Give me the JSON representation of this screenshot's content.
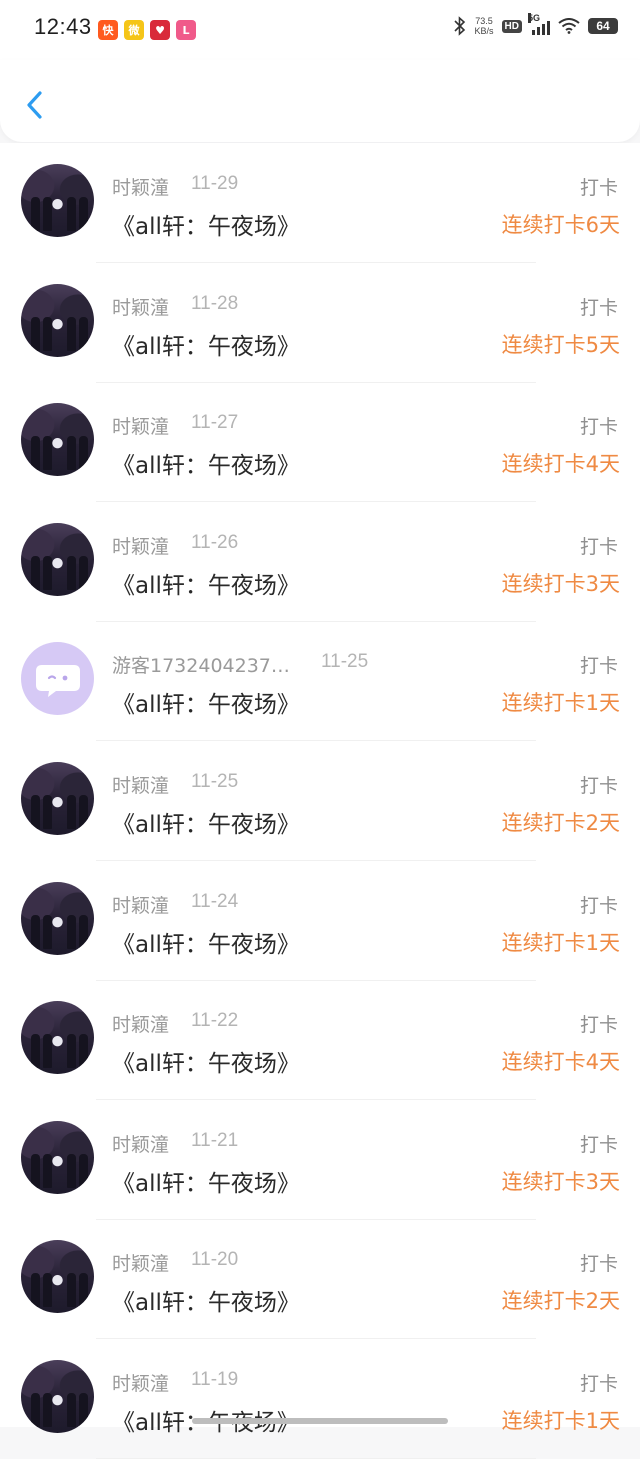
{
  "status_bar": {
    "time": "12:43",
    "app_icons": [
      {
        "name": "kuaishou-icon",
        "glyph": "快",
        "color": "#ff5a1f"
      },
      {
        "name": "weibo-icon",
        "glyph": "微",
        "color": "#f5c518"
      },
      {
        "name": "heart-app-icon",
        "glyph": "♥",
        "color": "#d92a3a"
      },
      {
        "name": "lofter-icon",
        "glyph": "L",
        "color": "#f05a8a"
      }
    ],
    "net_speed_value": "73.5",
    "net_speed_unit": "KB/s",
    "hd": "HD",
    "network": "5G",
    "battery": "64"
  },
  "header": {
    "back_icon": "chevron-left-icon",
    "accent_color": "#2d9cf0"
  },
  "colors": {
    "streak": "#ef8a43",
    "guest_avatar": "#d6c9f5"
  },
  "items": [
    {
      "name": "时颖潼",
      "date": "11-29",
      "title": "《all轩：午夜场》",
      "type": "打卡",
      "streak": "连续打卡6天",
      "avatar": "photo"
    },
    {
      "name": "时颖潼",
      "date": "11-28",
      "title": "《all轩：午夜场》",
      "type": "打卡",
      "streak": "连续打卡5天",
      "avatar": "photo"
    },
    {
      "name": "时颖潼",
      "date": "11-27",
      "title": "《all轩：午夜场》",
      "type": "打卡",
      "streak": "连续打卡4天",
      "avatar": "photo"
    },
    {
      "name": "时颖潼",
      "date": "11-26",
      "title": "《all轩：午夜场》",
      "type": "打卡",
      "streak": "连续打卡3天",
      "avatar": "photo"
    },
    {
      "name": "游客1732404237…",
      "date": "11-25",
      "title": "《all轩：午夜场》",
      "type": "打卡",
      "streak": "连续打卡1天",
      "avatar": "guest"
    },
    {
      "name": "时颖潼",
      "date": "11-25",
      "title": "《all轩：午夜场》",
      "type": "打卡",
      "streak": "连续打卡2天",
      "avatar": "photo"
    },
    {
      "name": "时颖潼",
      "date": "11-24",
      "title": "《all轩：午夜场》",
      "type": "打卡",
      "streak": "连续打卡1天",
      "avatar": "photo"
    },
    {
      "name": "时颖潼",
      "date": "11-22",
      "title": "《all轩：午夜场》",
      "type": "打卡",
      "streak": "连续打卡4天",
      "avatar": "photo"
    },
    {
      "name": "时颖潼",
      "date": "11-21",
      "title": "《all轩：午夜场》",
      "type": "打卡",
      "streak": "连续打卡3天",
      "avatar": "photo"
    },
    {
      "name": "时颖潼",
      "date": "11-20",
      "title": "《all轩：午夜场》",
      "type": "打卡",
      "streak": "连续打卡2天",
      "avatar": "photo"
    },
    {
      "name": "时颖潼",
      "date": "11-19",
      "title": "《all轩：午夜场》",
      "type": "打卡",
      "streak": "连续打卡1天",
      "avatar": "photo"
    }
  ]
}
